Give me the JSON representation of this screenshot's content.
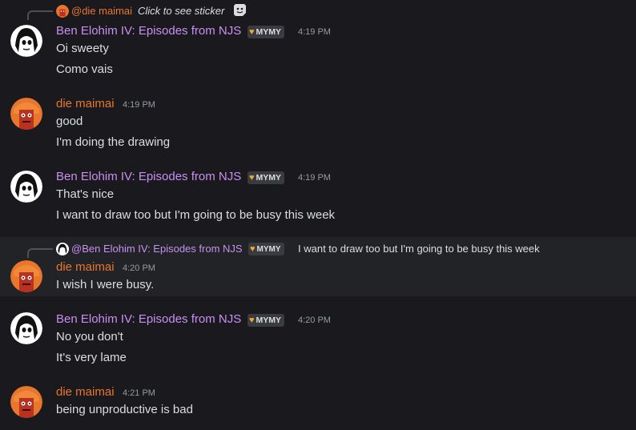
{
  "users": {
    "ben": "Ben Elohim IV: Episodes from NJS",
    "die": "die maimai",
    "ben_mention": "@Ben Elohim IV: Episodes from NJS",
    "die_mention": "@die maimai"
  },
  "tag": {
    "label": "MYMY",
    "icon": "heart-icon",
    "heart_color": "#f0a830"
  },
  "colors": {
    "ben": "#c98ff2",
    "die": "#e8762d",
    "background": "#1a1a1e"
  },
  "reply1": {
    "sticker_label": "Click to see sticker",
    "icon": "sticker-icon"
  },
  "messages": [
    {
      "author": "Ben Elohim IV: Episodes from NJS",
      "time": "4:19 PM",
      "lines": [
        "Oi sweety",
        "Como vais"
      ]
    },
    {
      "author": "die maimai",
      "time": "4:19 PM",
      "lines": [
        "good",
        "I'm doing the drawing"
      ]
    },
    {
      "author": "Ben Elohim IV: Episodes from NJS",
      "time": "4:19 PM",
      "lines": [
        "That's nice",
        "I want to draw too but I'm going to be busy this week"
      ]
    },
    {
      "author": "die maimai",
      "time": "4:20 PM",
      "lines": [
        "I wish I were busy."
      ]
    },
    {
      "author": "Ben Elohim IV: Episodes from NJS",
      "time": "4:20 PM",
      "lines": [
        "No you don't",
        "It's very lame"
      ]
    },
    {
      "author": "die maimai",
      "time": "4:21 PM",
      "lines": [
        "being unproductive is bad"
      ]
    }
  ],
  "reply2": {
    "text": "I want to draw too but I'm going to be busy this week"
  }
}
